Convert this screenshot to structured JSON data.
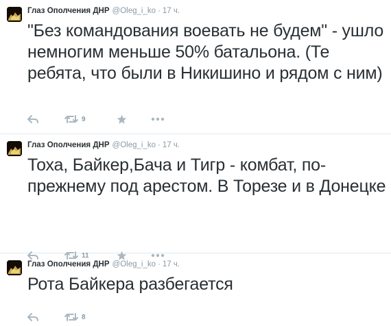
{
  "tweets": [
    {
      "author": "Глаз Ополчения ДНР",
      "handle": "@Oleg_i_ko",
      "separator": "·",
      "time": "17 ч.",
      "text": "\"Без командования воевать не будем\" - ушло немногим меньше 50% батальона. (Те ребята, что были в Никишино и рядом с ним)",
      "retweets": "9"
    },
    {
      "author": "Глаз Ополчения ДНР",
      "handle": "@Oleg_i_ko",
      "separator": "·",
      "time": "17 ч.",
      "text": "Тоха, Байкер,Бача и Тигр - комбат, по-прежнему под арестом. В Торезе и в Донецке",
      "retweets": "11"
    },
    {
      "author": "Глаз Ополчения ДНР",
      "handle": "@Oleg_i_ko",
      "separator": "·",
      "time": "17 ч.",
      "text": "Рота Байкера разбегается",
      "retweets": "8"
    }
  ],
  "icons": {
    "reply": "reply-icon",
    "retweet": "retweet-icon",
    "favorite": "star-icon",
    "more": "more-icon"
  },
  "colors": {
    "text": "#292f33",
    "meta": "#8899a6",
    "action": "#aab8c2",
    "divider": "#e1e8ed"
  }
}
